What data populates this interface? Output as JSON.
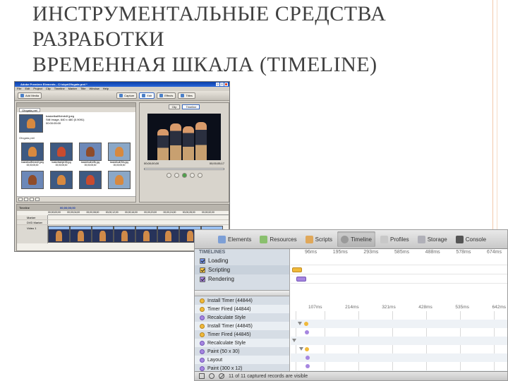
{
  "slide": {
    "title_lines": [
      "ИНСТРУМЕНТАЛЬНЫЕ СРЕДСТВА",
      "РАЗРАБОТКИ",
      "ВРЕМЕННАЯ ШКАЛА (TIMELINE)"
    ]
  },
  "premiere": {
    "window_title": "Adobe Premiere Elements - C:\\skya\\Gfogata.prel *",
    "menu": [
      "File",
      "Edit",
      "Project",
      "Clip",
      "Timeline",
      "Marker",
      "Title",
      "Window",
      "Help"
    ],
    "toolbar": [
      "Add Media",
      "Capture",
      "Edit",
      "Effects",
      "Titles"
    ],
    "media_panel": {
      "tab": "Gfogata.prel",
      "preview_info": [
        "basketball9dmb4f.jpeg",
        "Still Image, 640 x 480 (0.9091)",
        "00:00:05:00"
      ],
      "folder_label": "Gfogata.prel",
      "items": [
        {
          "name": "basketball9dmb4f.jpeg",
          "duration": "00;00;05;00"
        },
        {
          "name": "basketballpb3l8.jpg",
          "duration": "00;00;05;00"
        },
        {
          "name": "basketball4d9k.jpg",
          "duration": "00;00;05;00"
        },
        {
          "name": "basketball25bv.jpg",
          "duration": "00;00;05;00"
        }
      ]
    },
    "monitor": {
      "tabs": [
        "Clip",
        "Timeline"
      ],
      "timecode_left": "00;00;00;00",
      "timecode_right": "00;00;05;17"
    },
    "timeline": {
      "title": "Timeline",
      "timecode": "00;00;00;00",
      "ruler": [
        "00;00;00;00",
        "00;00;04;00",
        "00;00;08;00",
        "00;00;12;00",
        "00;00;16;00",
        "00;00;20;00",
        "00;00;24;00",
        "00;00;28;00",
        "00;00;32;00"
      ],
      "tracks": [
        "Marker",
        "DVD Marker"
      ],
      "video_track": "Video 1"
    }
  },
  "inspector": {
    "tabs": [
      "Elements",
      "Resources",
      "Scripts",
      "Timeline",
      "Profiles",
      "Storage",
      "Console"
    ],
    "active_tab": "Timeline",
    "overview_header": "TIMELINES",
    "categories": [
      "Loading",
      "Scripting",
      "Rendering"
    ],
    "overview_ticks": [
      "96ms",
      "195ms",
      "293ms",
      "585ms",
      "488ms",
      "578ms",
      "674ms"
    ],
    "record_ticks": [
      "107ms",
      "214ms",
      "321ms",
      "428ms",
      "535ms",
      "642ms"
    ],
    "records": [
      {
        "label": "Install Timer (44844)",
        "dot": "yellow"
      },
      {
        "label": "Timer Fired (44844)",
        "dot": "yellow"
      },
      {
        "label": "Recalculate Style",
        "dot": "purple"
      },
      {
        "label": "Install Timer (44845)",
        "dot": "yellow"
      },
      {
        "label": "Timer Fired (44845)",
        "dot": "yellow"
      },
      {
        "label": "Recalculate Style",
        "dot": "purple"
      },
      {
        "label": "Paint (50 x 30)",
        "dot": "purple"
      },
      {
        "label": "Layout",
        "dot": "purple"
      },
      {
        "label": "Paint (300 x 12)",
        "dot": "purple"
      }
    ],
    "status_text": "11 of 11 captured records are visible",
    "colors": {
      "scripting": "#f0b93a",
      "rendering": "#a686e0",
      "loading": "#6f8ee0"
    }
  }
}
